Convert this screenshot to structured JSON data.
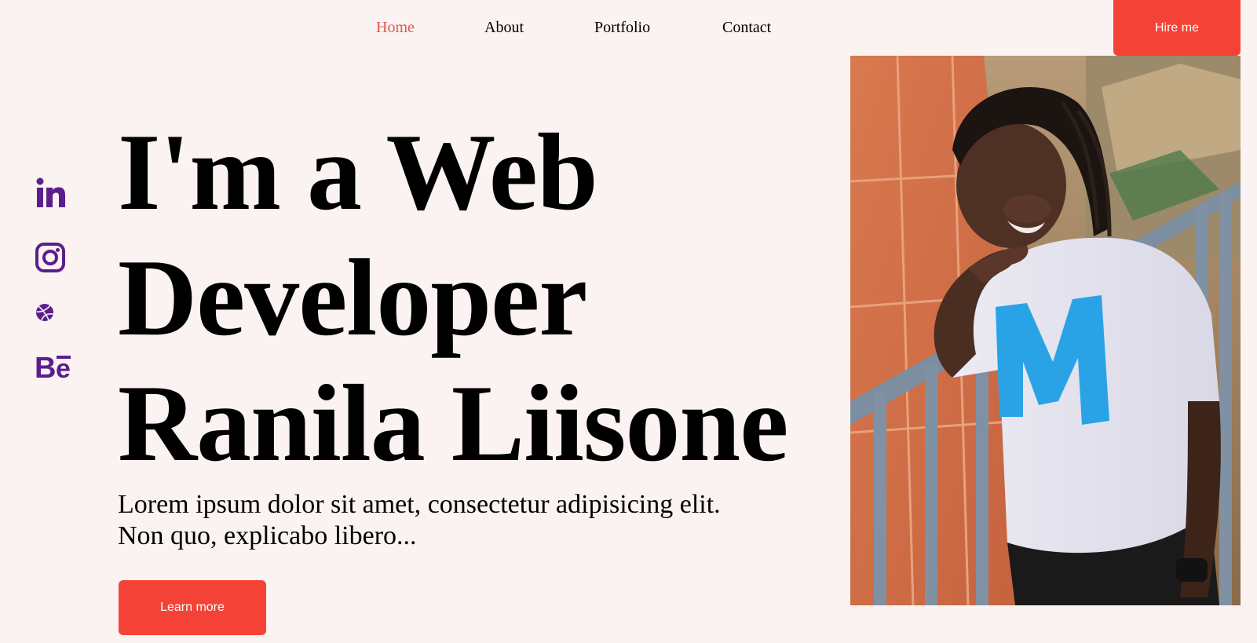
{
  "nav": {
    "links": [
      "Home",
      "About",
      "Portfolio",
      "Contact"
    ],
    "active": "Home",
    "hire_label": "Hire me"
  },
  "socials": [
    {
      "icon": "linkedin-icon",
      "label": "in"
    },
    {
      "icon": "instagram-icon"
    },
    {
      "icon": "dribbble-icon"
    },
    {
      "icon": "behance-icon",
      "label": "Bē"
    }
  ],
  "hero": {
    "headline_lines": [
      "I'm a Web",
      "Developer",
      "Ranila Liisone"
    ],
    "lead": "Lorem ipsum dolor sit amet, consectetur adipisicing elit. Non quo, explicabo libero...",
    "cta_label": "Learn more"
  },
  "colors": {
    "background": "#faf3f1",
    "accent": "#f44336",
    "active_link": "#e2574c",
    "social_icons": "#5b1e8c"
  }
}
